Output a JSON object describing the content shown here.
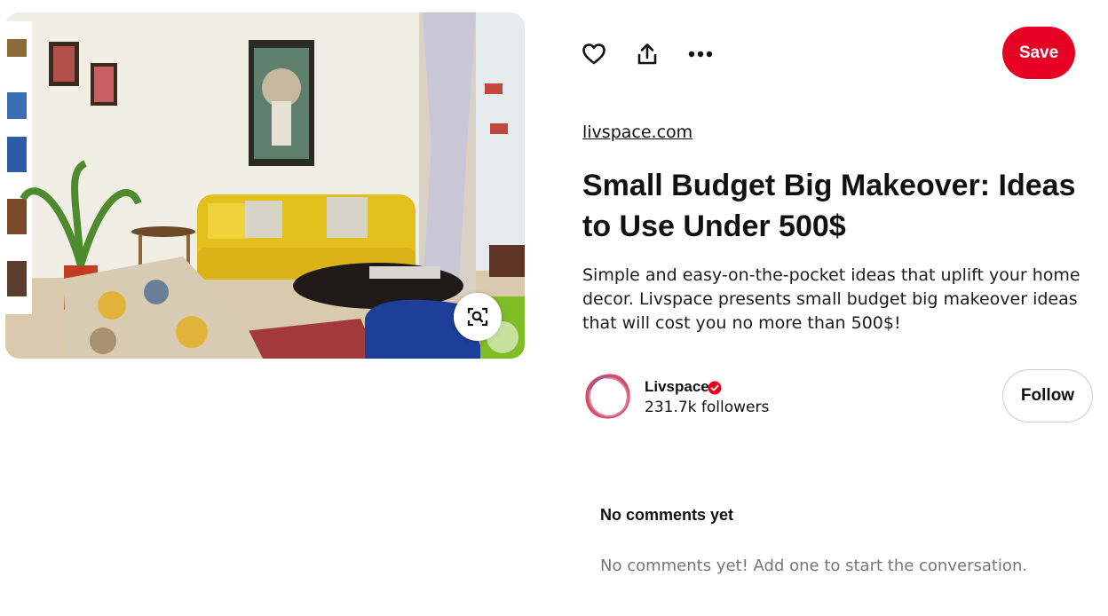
{
  "pin": {
    "source": "livspace.com",
    "title": "Small Budget Big Makeover: Ideas to Use Under 500$",
    "description": "Simple and easy-on-the-pocket ideas that uplift your home decor. Livspace presents small budget big makeover ideas that will cost you no more than 500$!"
  },
  "actions": {
    "like_icon": "heart-icon",
    "share_icon": "share-icon",
    "more_icon": "more-icon",
    "save_label": "Save"
  },
  "creator": {
    "name": "Livspace",
    "verified": true,
    "followers": "231.7k followers",
    "follow_label": "Follow"
  },
  "comments": {
    "heading": "No comments yet",
    "empty_message": "No comments yet! Add one to start the conversation."
  },
  "colors": {
    "save_red": "#e60023",
    "verified_red": "#e60023",
    "muted_text": "#767676"
  }
}
